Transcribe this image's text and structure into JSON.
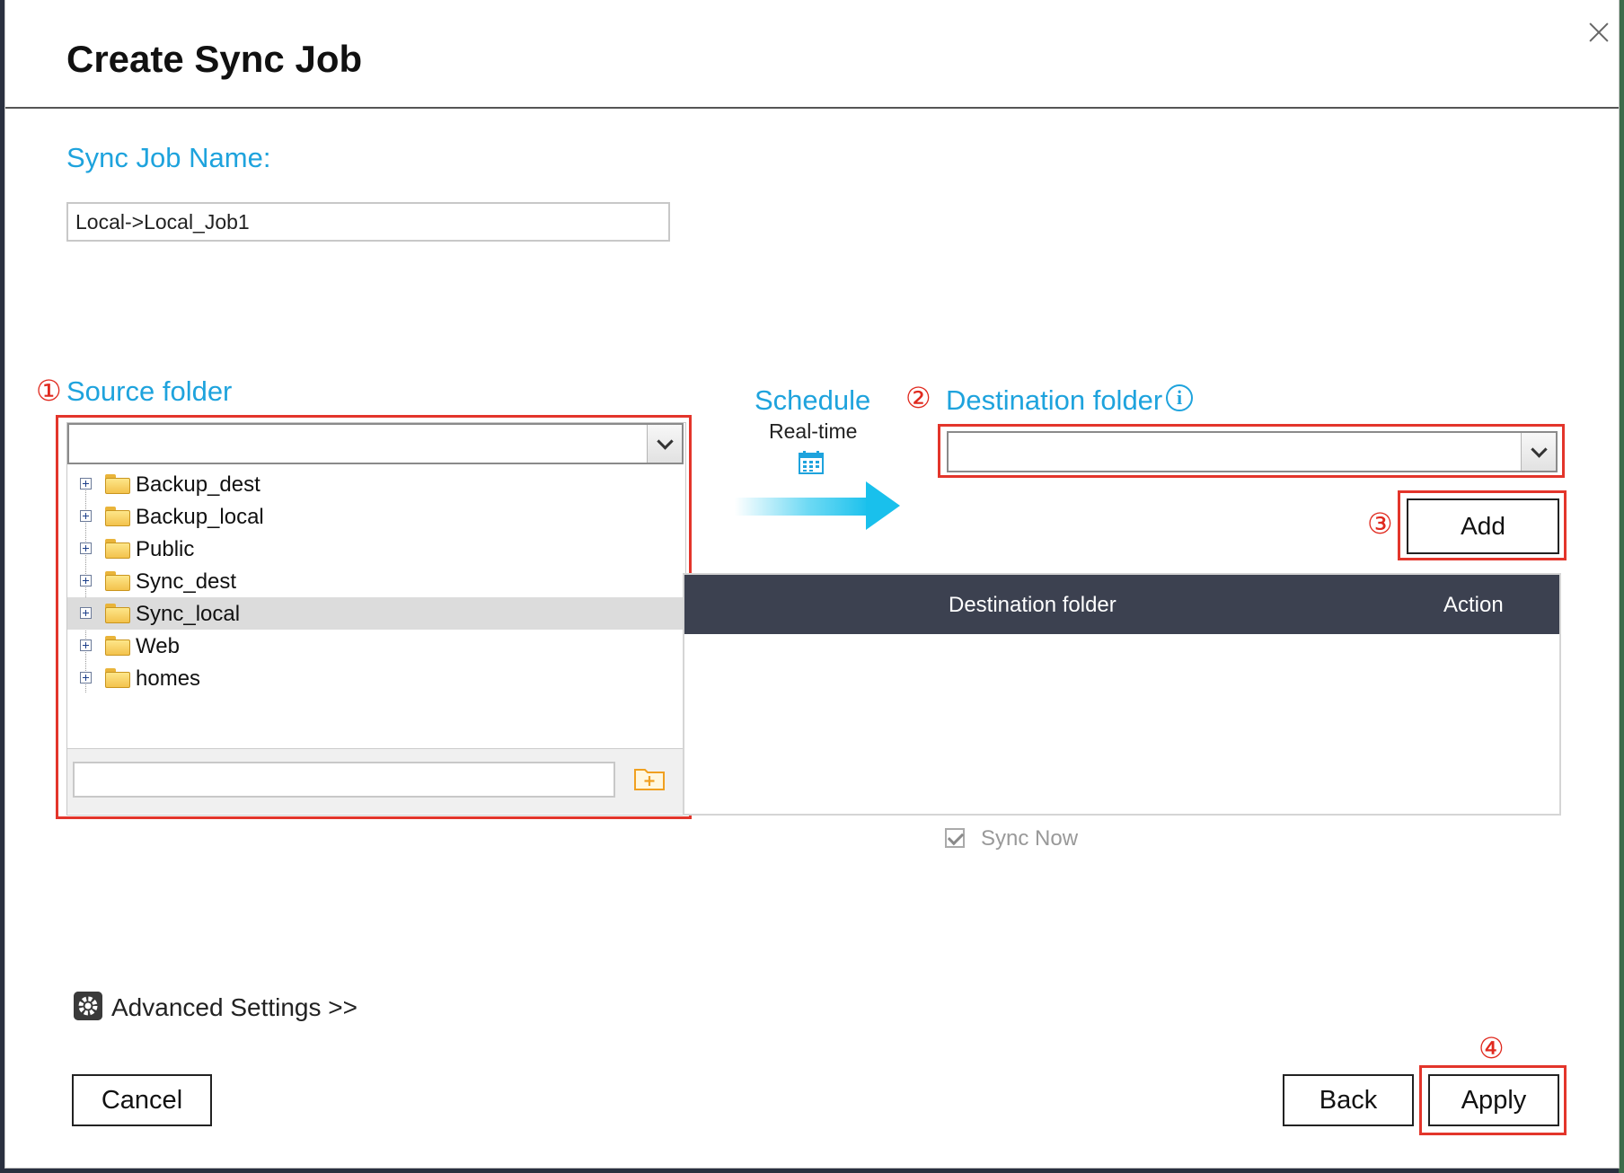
{
  "dialog": {
    "title": "Create Sync Job"
  },
  "job_name": {
    "label": "Sync Job Name:",
    "value": "Local->Local_Job1"
  },
  "source": {
    "marker": "①",
    "label": "Source folder",
    "folders": [
      {
        "label": "Backup_dest",
        "selected": false
      },
      {
        "label": "Backup_local",
        "selected": false
      },
      {
        "label": "Public",
        "selected": false
      },
      {
        "label": "Sync_dest",
        "selected": false
      },
      {
        "label": "Sync_local",
        "selected": true
      },
      {
        "label": "Web",
        "selected": false
      },
      {
        "label": "homes",
        "selected": false
      }
    ],
    "new_folder_placeholder": ""
  },
  "schedule": {
    "label": "Schedule",
    "value": "Real-time",
    "icon": "calendar-icon"
  },
  "destination": {
    "marker": "②",
    "label": "Destination folder",
    "info_icon_glyph": "i",
    "add_marker": "③",
    "add_label": "Add",
    "table_headers": {
      "destination": "Destination folder",
      "action": "Action"
    }
  },
  "sync_now": {
    "label": "Sync Now",
    "checked": true
  },
  "advanced": {
    "label": "Advanced Settings >>"
  },
  "footer": {
    "cancel": "Cancel",
    "back": "Back",
    "apply": "Apply",
    "apply_marker": "④"
  },
  "colors": {
    "accent": "#1ea3dd",
    "highlight": "#e3352b",
    "table_header": "#3c4150"
  }
}
